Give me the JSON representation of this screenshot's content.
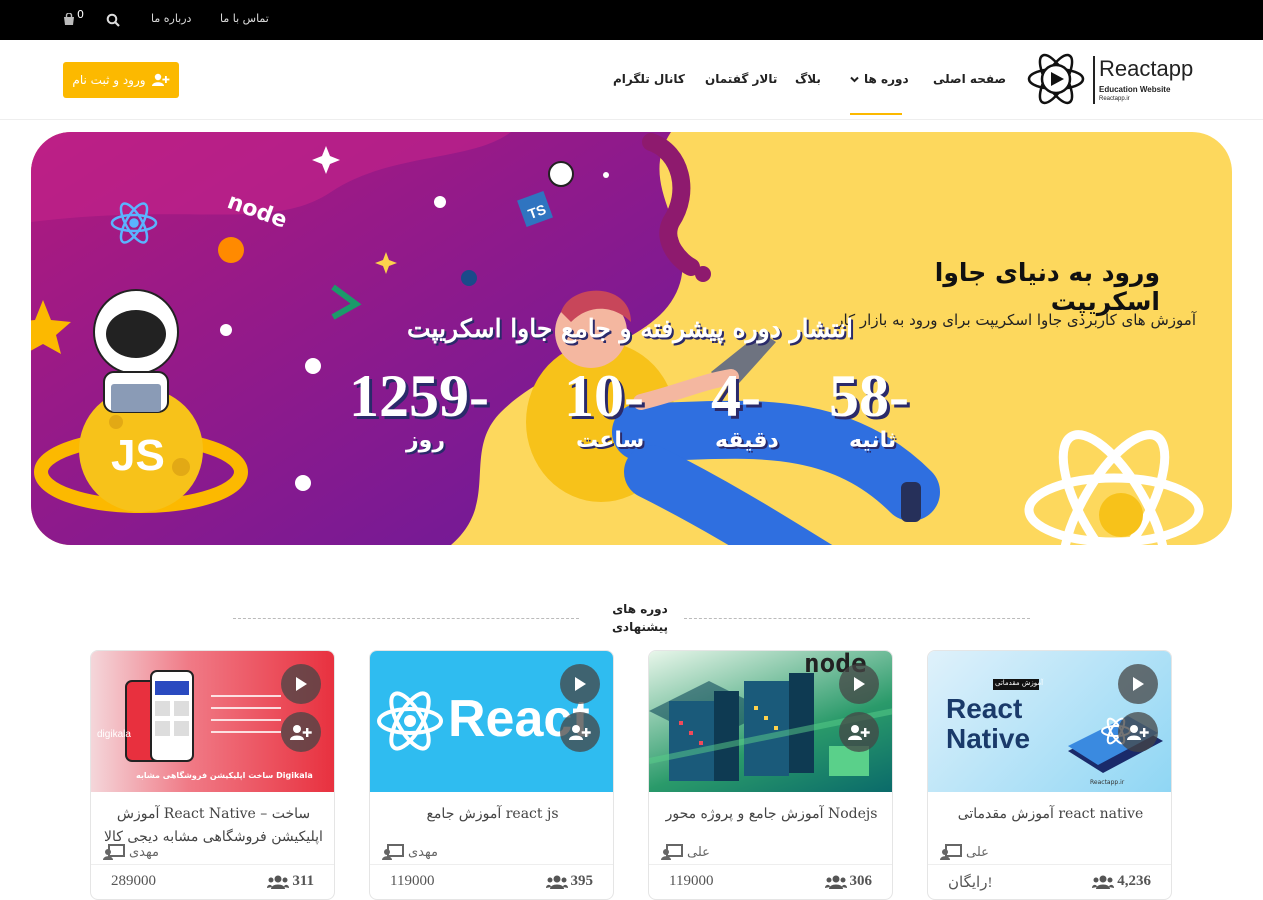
{
  "topbar": {
    "cart_count": "0",
    "links": [
      "تماس با ما",
      "درباره ما"
    ]
  },
  "header": {
    "login_label": "ورود و ثبت نام",
    "nav": [
      "صفحه اصلی",
      "دوره ها",
      "بلاگ",
      "تالار گفتمان",
      "کانال تلگرام"
    ],
    "logo": {
      "brand": "Reactapp",
      "tagline": "Education Website",
      "domain": "Reactapp.ir"
    }
  },
  "banner": {
    "title": "ورود به دنیای جاوا اسکریپت",
    "subtitle": "آموزش های کاربردی جاوا اسکریپت برای ورود به بازار کار",
    "release": "انتشار دوره پیشرفته و جامع جاوا اسکریپت",
    "countdown": [
      {
        "value": "58-",
        "label": "ثانیه"
      },
      {
        "value": "4-",
        "label": "دقیقه"
      },
      {
        "value": "10-",
        "label": "ساعت"
      },
      {
        "value": "1259-",
        "label": "روز"
      }
    ],
    "badges": {
      "js": "JS",
      "ts": "TS",
      "node": "node"
    }
  },
  "section": {
    "title_line1": "دوره های",
    "title_line2": "پیشنهادی"
  },
  "courses": [
    {
      "title": "آموزش مقدماتی react native",
      "teacher": "علی",
      "students": "4,236",
      "price": "رایگان!",
      "thumb_text1": "React",
      "thumb_text2": "Native",
      "thumb_badge": "آموزش مقدماتی",
      "thumb_domain": "Reactapp.ir"
    },
    {
      "title": "آموزش جامع و پروژه محور Nodejs",
      "teacher": "علی",
      "students": "306",
      "price": "119000",
      "thumb_text1": "node"
    },
    {
      "title": "آموزش جامع react js",
      "teacher": "مهدی",
      "students": "395",
      "price": "119000",
      "thumb_text1": "React"
    },
    {
      "title": "آموزش React Native – ساخت اپلیکیشن فروشگاهی مشابه دیجی کالا",
      "teacher": "مهدی",
      "students": "311",
      "price": "289000",
      "thumb_text1": "ساخت اپلیکیشن فروشگاهی مشابه Digikala",
      "thumb_text2": "digikala"
    }
  ],
  "colors": {
    "accent": "#fcb900",
    "banner_purple": "#8e1a8e",
    "banner_yellow": "#fdd85d"
  }
}
